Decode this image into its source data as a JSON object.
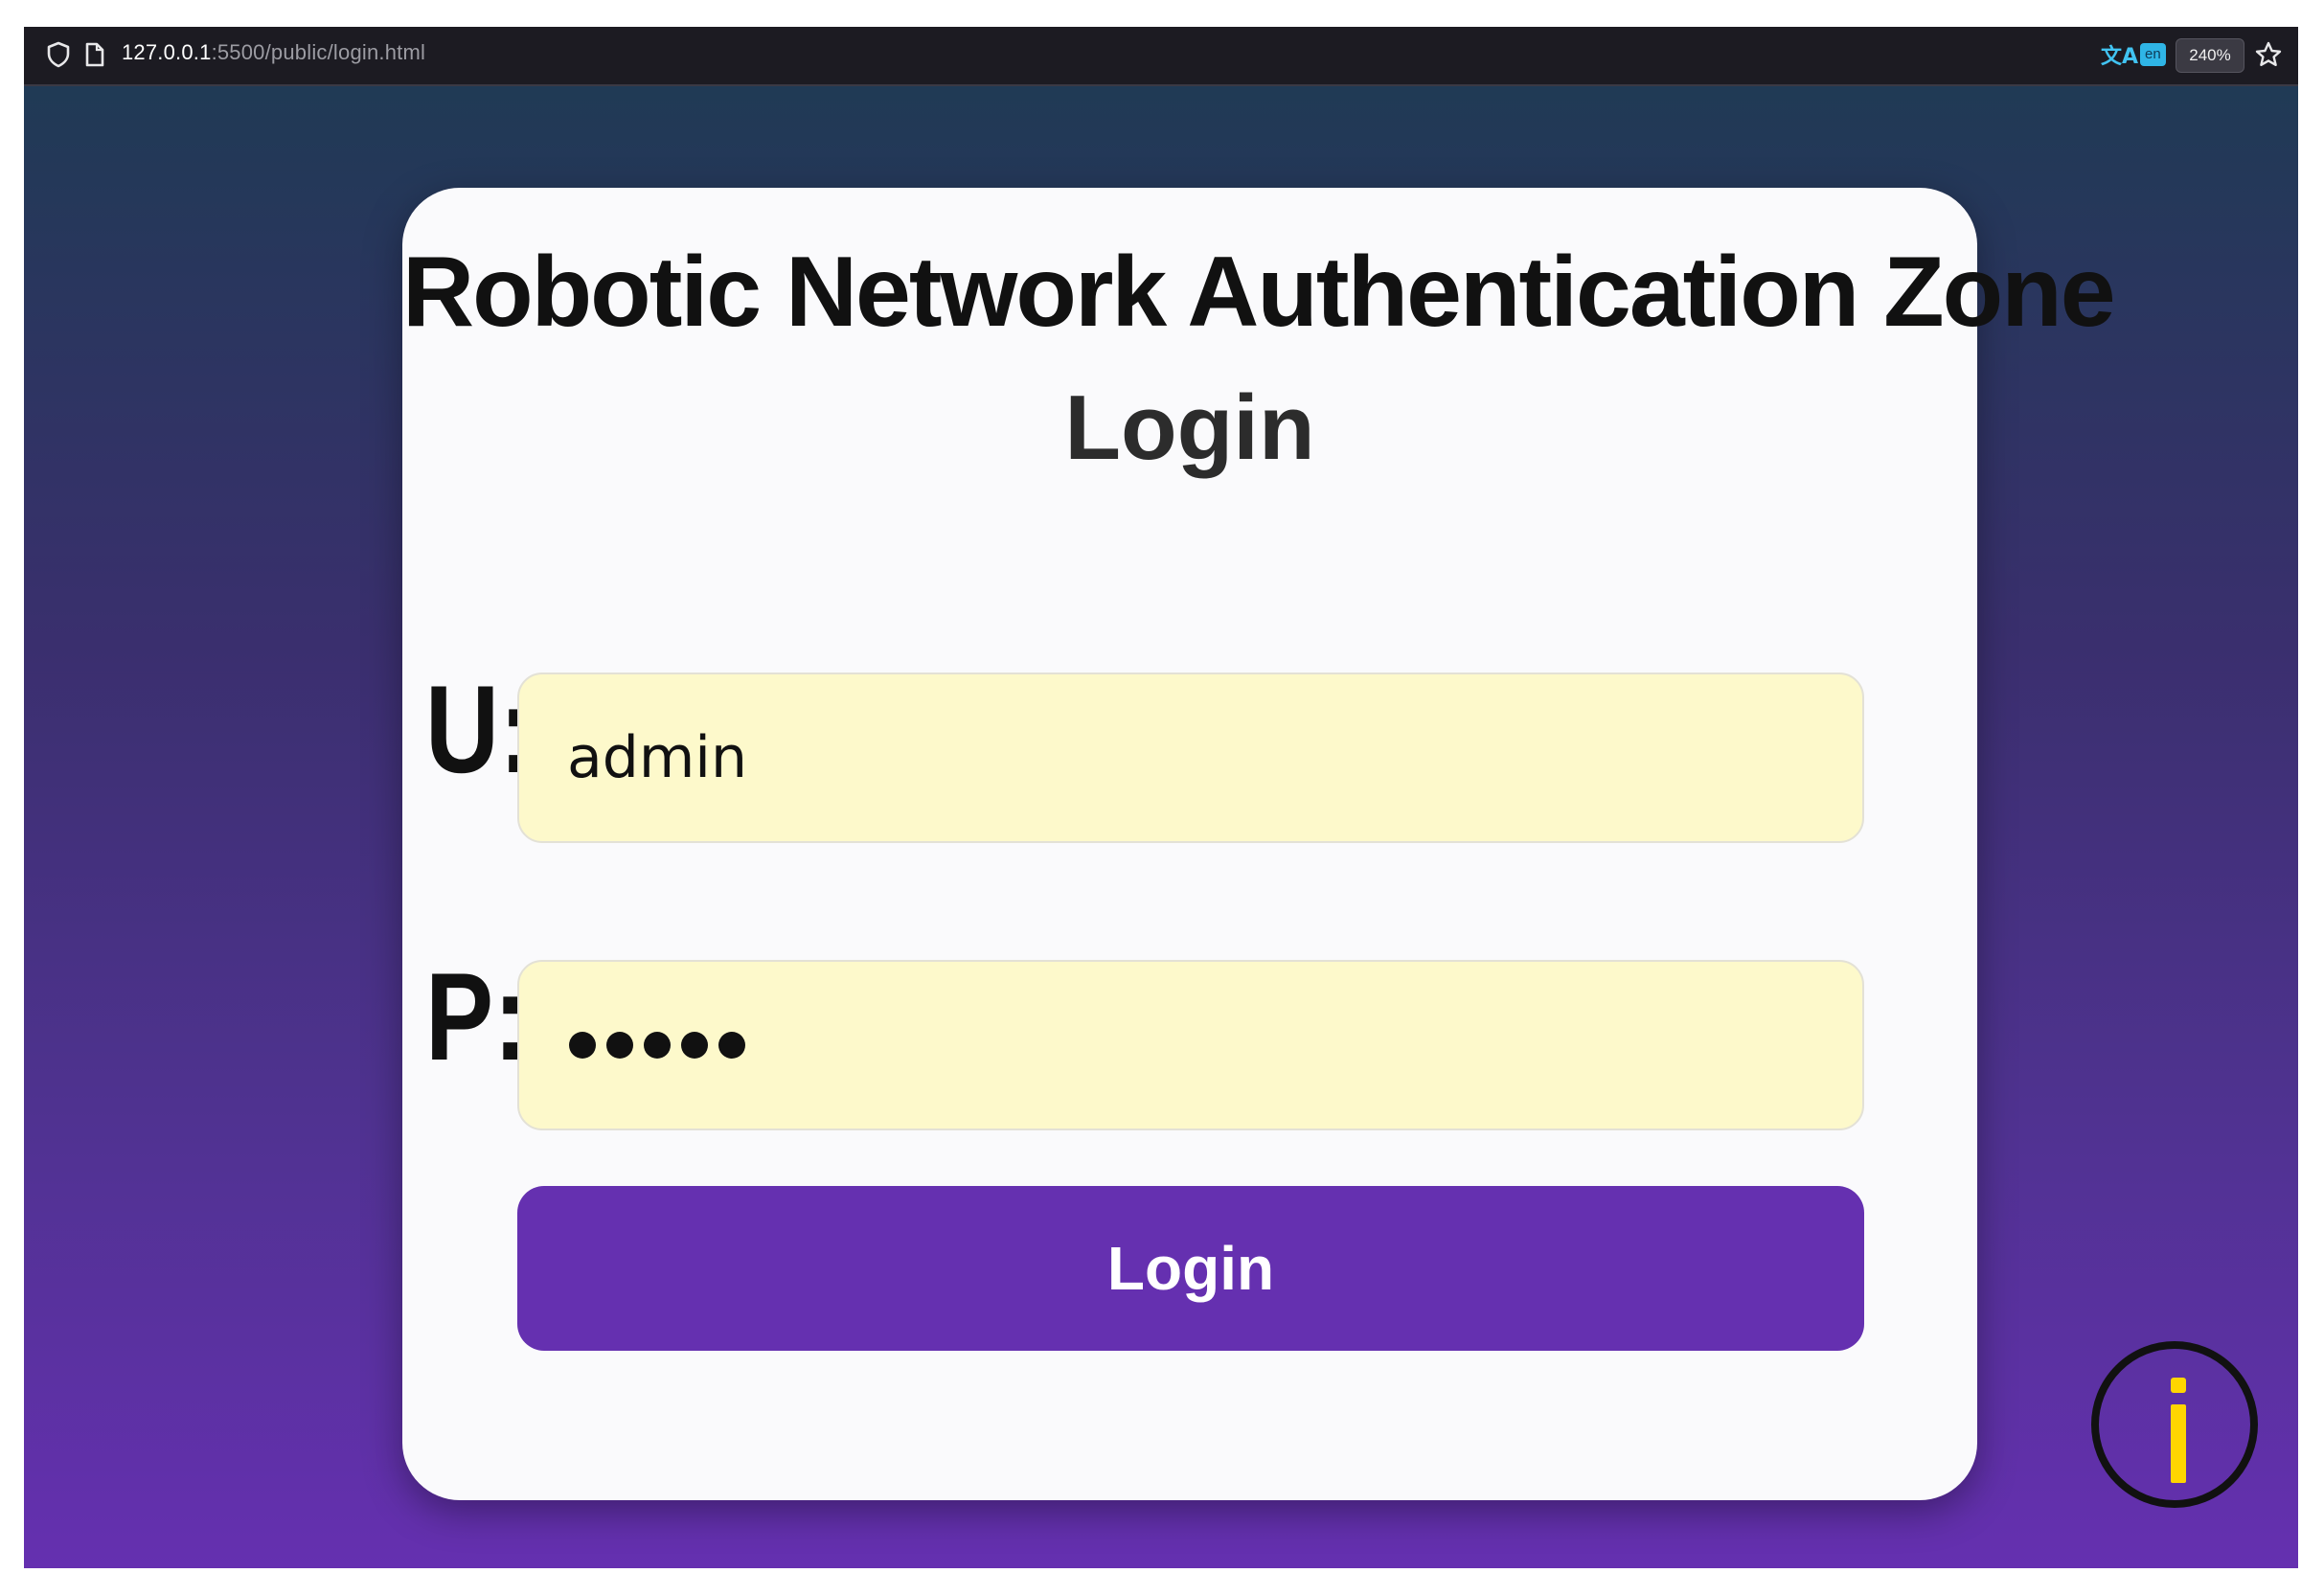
{
  "browser": {
    "url_host": "127.0.0.1",
    "url_rest": ":5500/public/login.html",
    "translate_lang": "en",
    "zoom_level": "240%",
    "icons": [
      "shield-icon",
      "page-icon",
      "translate-icon",
      "bookmark-star-icon"
    ]
  },
  "card": {
    "title": "Robotic Network Authentication Zone",
    "subtitle": "Login"
  },
  "form": {
    "username_label": "U:",
    "username_value": "admin",
    "password_label": "P:",
    "password_length": 5,
    "login_button": "Login"
  },
  "colors": {
    "gradient_top": "#1d3b52",
    "gradient_bottom": "#6530b0",
    "input_background": "#fdf9cb",
    "button_background": "#6530b0",
    "info_accent": "#ffd500"
  },
  "info": {
    "icon": "info-icon"
  }
}
